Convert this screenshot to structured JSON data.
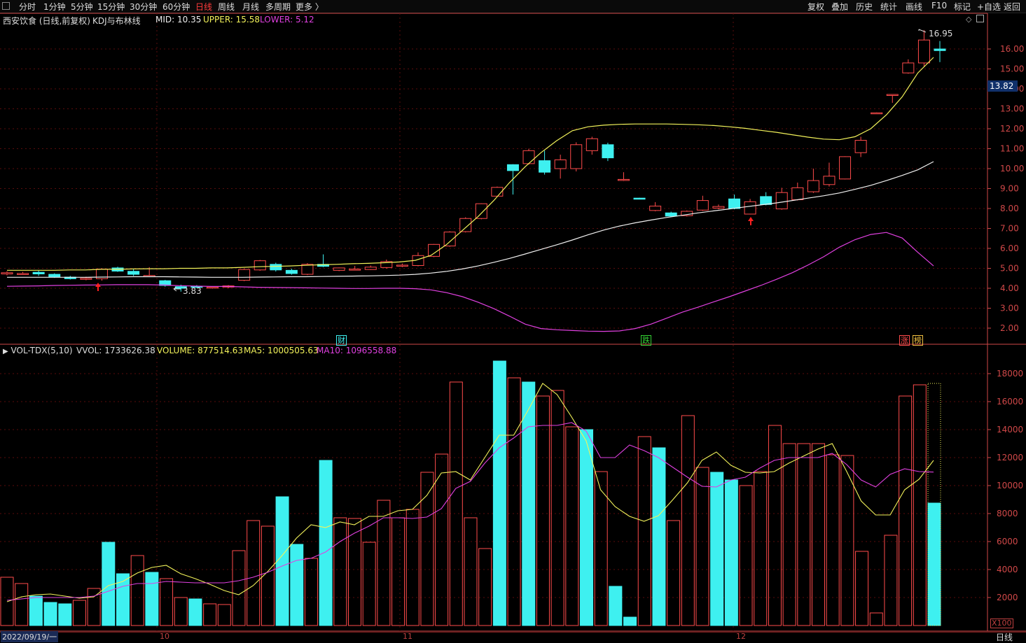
{
  "toolbar": {
    "left_items": [
      "分时",
      "1分钟",
      "5分钟",
      "15分钟",
      "30分钟",
      "60分钟",
      "日线",
      "周线",
      "月线",
      "多周期",
      "更多 〉"
    ],
    "active": "日线",
    "right_items": [
      "复权",
      "叠加",
      "历史",
      "统计",
      "画线",
      "F10",
      "标记",
      "+自选",
      "返回"
    ]
  },
  "main_info": {
    "title": "西安饮食 (日线,前复权)",
    "indicator": "KDJ与布林线",
    "mid": "MID: 10.35",
    "upper": "UPPER: 15.58",
    "lower": "LOWER: 5.12"
  },
  "vol_info": {
    "indicator": "VOL-TDX(5,10)",
    "vvol": "VVOL: 1733626.38",
    "volume": "VOLUME: 877514.63",
    "ma5": "MA5: 1000505.63",
    "ma10": "MA10: 1096558.88"
  },
  "colors": {
    "up": "#ff4b4b",
    "down": "#3ef0f0",
    "upper": "#f2f25a",
    "mid": "#f0f0f0",
    "lower": "#e040e0",
    "grid": "#5a0d0d",
    "axis": "#d04848"
  },
  "price_axis": [
    "16.00",
    "15.00",
    "14.00",
    "13.00",
    "12.00",
    "11.00",
    "10.00",
    "9.00",
    "8.00",
    "7.00",
    "6.00",
    "5.00",
    "4.00",
    "3.00",
    "2.00"
  ],
  "vol_axis": [
    "18000",
    "16000",
    "14000",
    "12000",
    "10000",
    "8000",
    "6000",
    "4000",
    "2000"
  ],
  "current_price": "13.82",
  "high_label": "16.95",
  "low_label": "3.83",
  "x_labels": [
    "10",
    "11",
    "12"
  ],
  "status": {
    "date": "2022/09/19/一",
    "period": "日线",
    "scale": "X100"
  },
  "markers": [
    {
      "text": "财",
      "color": "#3ef0f0"
    },
    {
      "text": "跌",
      "color": "#34d034"
    },
    {
      "text": "涨",
      "color": "#ff4b4b"
    },
    {
      "text": "榜",
      "color": "#f0c040"
    }
  ],
  "chart_data": {
    "type": "candlestick",
    "candles": [
      {
        "o": 4.72,
        "h": 4.85,
        "l": 4.65,
        "c": 4.78
      },
      {
        "o": 4.72,
        "h": 4.82,
        "l": 4.68,
        "c": 4.74
      },
      {
        "o": 4.8,
        "h": 4.88,
        "l": 4.62,
        "c": 4.72
      },
      {
        "o": 4.7,
        "h": 4.75,
        "l": 4.52,
        "c": 4.58
      },
      {
        "o": 4.56,
        "h": 4.62,
        "l": 4.44,
        "c": 4.48
      },
      {
        "o": 4.45,
        "h": 4.58,
        "l": 4.4,
        "c": 4.5
      },
      {
        "o": 4.48,
        "h": 5.0,
        "l": 4.38,
        "c": 4.96
      },
      {
        "o": 5.02,
        "h": 5.08,
        "l": 4.82,
        "c": 4.86
      },
      {
        "o": 4.85,
        "h": 4.95,
        "l": 4.62,
        "c": 4.7
      },
      {
        "o": 4.62,
        "h": 5.06,
        "l": 4.56,
        "c": 4.64
      },
      {
        "o": 4.38,
        "h": 4.42,
        "l": 4.08,
        "c": 4.14
      },
      {
        "o": 4.08,
        "h": 4.18,
        "l": 3.83,
        "c": 4.0
      },
      {
        "o": 4.1,
        "h": 4.16,
        "l": 4.02,
        "c": 4.06
      },
      {
        "o": 4.02,
        "h": 4.1,
        "l": 3.98,
        "c": 4.06
      },
      {
        "o": 4.06,
        "h": 4.16,
        "l": 4.0,
        "c": 4.12
      },
      {
        "o": 4.4,
        "h": 4.98,
        "l": 4.36,
        "c": 4.94
      },
      {
        "o": 4.92,
        "h": 5.42,
        "l": 4.88,
        "c": 5.38
      },
      {
        "o": 5.2,
        "h": 5.28,
        "l": 4.84,
        "c": 4.92
      },
      {
        "o": 4.9,
        "h": 4.98,
        "l": 4.68,
        "c": 4.74
      },
      {
        "o": 4.7,
        "h": 5.26,
        "l": 4.66,
        "c": 5.2
      },
      {
        "o": 5.2,
        "h": 5.7,
        "l": 5.06,
        "c": 5.1
      },
      {
        "o": 4.9,
        "h": 5.04,
        "l": 4.86,
        "c": 5.02
      },
      {
        "o": 4.94,
        "h": 5.12,
        "l": 4.9,
        "c": 4.96
      },
      {
        "o": 4.94,
        "h": 5.14,
        "l": 4.92,
        "c": 5.06
      },
      {
        "o": 5.04,
        "h": 5.44,
        "l": 4.98,
        "c": 5.34
      },
      {
        "o": 5.12,
        "h": 5.24,
        "l": 5.06,
        "c": 5.16
      },
      {
        "o": 5.14,
        "h": 5.8,
        "l": 5.1,
        "c": 5.64
      },
      {
        "o": 5.6,
        "h": 6.22,
        "l": 5.56,
        "c": 6.2
      },
      {
        "o": 6.12,
        "h": 6.86,
        "l": 6.08,
        "c": 6.82
      },
      {
        "o": 6.84,
        "h": 7.56,
        "l": 6.8,
        "c": 7.5
      },
      {
        "o": 7.5,
        "h": 8.26,
        "l": 7.46,
        "c": 8.24
      },
      {
        "o": 8.62,
        "h": 9.1,
        "l": 8.6,
        "c": 9.06
      },
      {
        "o": 10.2,
        "h": 10.22,
        "l": 8.7,
        "c": 9.9
      },
      {
        "o": 10.25,
        "h": 11.0,
        "l": 10.2,
        "c": 10.9
      },
      {
        "o": 10.4,
        "h": 10.9,
        "l": 9.7,
        "c": 9.82
      },
      {
        "o": 10.0,
        "h": 10.7,
        "l": 9.5,
        "c": 10.44
      },
      {
        "o": 10.0,
        "h": 11.32,
        "l": 9.86,
        "c": 11.2
      },
      {
        "o": 10.9,
        "h": 11.6,
        "l": 10.7,
        "c": 11.5
      },
      {
        "o": 11.2,
        "h": 11.3,
        "l": 10.38,
        "c": 10.54
      },
      {
        "o": 9.46,
        "h": 9.82,
        "l": 9.38,
        "c": 9.46
      },
      {
        "o": 8.52,
        "h": 8.54,
        "l": 8.48,
        "c": 8.5
      },
      {
        "o": 7.9,
        "h": 8.32,
        "l": 7.86,
        "c": 8.12
      },
      {
        "o": 7.78,
        "h": 7.84,
        "l": 7.58,
        "c": 7.62
      },
      {
        "o": 7.64,
        "h": 7.9,
        "l": 7.6,
        "c": 7.86
      },
      {
        "o": 7.92,
        "h": 8.64,
        "l": 7.88,
        "c": 8.4
      },
      {
        "o": 8.02,
        "h": 8.2,
        "l": 7.96,
        "c": 8.1
      },
      {
        "o": 8.48,
        "h": 8.7,
        "l": 7.96,
        "c": 8.0
      },
      {
        "o": 7.72,
        "h": 8.48,
        "l": 7.7,
        "c": 8.34
      },
      {
        "o": 8.6,
        "h": 8.82,
        "l": 8.16,
        "c": 8.2
      },
      {
        "o": 7.98,
        "h": 9.04,
        "l": 7.94,
        "c": 8.8
      },
      {
        "o": 8.44,
        "h": 9.3,
        "l": 8.4,
        "c": 9.04
      },
      {
        "o": 8.84,
        "h": 10.0,
        "l": 8.78,
        "c": 9.4
      },
      {
        "o": 9.2,
        "h": 10.3,
        "l": 9.1,
        "c": 9.62
      },
      {
        "o": 9.48,
        "h": 10.62,
        "l": 9.46,
        "c": 10.6
      },
      {
        "o": 10.8,
        "h": 11.6,
        "l": 10.58,
        "c": 11.42
      },
      {
        "o": 12.8,
        "h": 12.82,
        "l": 12.78,
        "c": 12.8
      },
      {
        "o": 13.7,
        "h": 13.72,
        "l": 13.3,
        "c": 13.72
      },
      {
        "o": 14.8,
        "h": 15.48,
        "l": 14.76,
        "c": 15.3
      },
      {
        "o": 15.3,
        "h": 16.95,
        "l": 15.1,
        "c": 16.45
      },
      {
        "o": 16.0,
        "h": 16.4,
        "l": 15.34,
        "c": 15.92
      }
    ],
    "upper": [
      4.9,
      4.9,
      4.9,
      4.9,
      4.92,
      4.92,
      4.95,
      4.95,
      4.97,
      4.98,
      4.98,
      5.0,
      5.0,
      5.02,
      5.02,
      5.05,
      5.08,
      5.1,
      5.12,
      5.15,
      5.18,
      5.2,
      5.23,
      5.25,
      5.28,
      5.32,
      5.4,
      5.65,
      6.2,
      6.9,
      7.6,
      8.4,
      9.3,
      10.1,
      10.8,
      11.4,
      11.9,
      12.1,
      12.18,
      12.22,
      12.24,
      12.24,
      12.24,
      12.22,
      12.2,
      12.16,
      12.1,
      12.02,
      11.92,
      11.82,
      11.7,
      11.58,
      11.48,
      11.45,
      11.6,
      12.0,
      12.7,
      13.6,
      14.8,
      15.58
    ],
    "mid": [
      4.55,
      4.55,
      4.55,
      4.55,
      4.55,
      4.55,
      4.56,
      4.57,
      4.58,
      4.58,
      4.58,
      4.57,
      4.56,
      4.55,
      4.55,
      4.55,
      4.56,
      4.57,
      4.58,
      4.58,
      4.59,
      4.6,
      4.61,
      4.62,
      4.64,
      4.66,
      4.7,
      4.76,
      4.85,
      4.97,
      5.12,
      5.3,
      5.5,
      5.72,
      5.95,
      6.18,
      6.42,
      6.68,
      6.92,
      7.12,
      7.28,
      7.42,
      7.55,
      7.66,
      7.78,
      7.88,
      7.98,
      8.08,
      8.18,
      8.28,
      8.4,
      8.52,
      8.64,
      8.78,
      8.96,
      9.16,
      9.4,
      9.66,
      9.94,
      10.35
    ],
    "lower": [
      4.1,
      4.11,
      4.12,
      4.14,
      4.15,
      4.16,
      4.17,
      4.18,
      4.18,
      4.18,
      4.16,
      4.13,
      4.11,
      4.09,
      4.09,
      4.07,
      4.05,
      4.04,
      4.03,
      4.02,
      4.01,
      4.0,
      3.99,
      3.99,
      4.0,
      4.0,
      3.98,
      3.92,
      3.78,
      3.58,
      3.3,
      2.98,
      2.6,
      2.2,
      1.98,
      1.92,
      1.88,
      1.85,
      1.84,
      1.86,
      1.98,
      2.2,
      2.5,
      2.8,
      3.05,
      3.32,
      3.58,
      3.86,
      4.14,
      4.45,
      4.78,
      5.16,
      5.58,
      6.06,
      6.44,
      6.7,
      6.8,
      6.52,
      5.8,
      5.12
    ],
    "volume": [
      3450,
      3000,
      2100,
      1650,
      1550,
      1800,
      2650,
      5950,
      3700,
      5000,
      3800,
      3350,
      2000,
      1900,
      1550,
      1500,
      5350,
      7500,
      7100,
      9200,
      5800,
      4800,
      11800,
      7700,
      7650,
      5950,
      8950,
      7700,
      8300,
      10950,
      12250,
      17400,
      7700,
      5500,
      18900,
      17700,
      17400,
      16400,
      16800,
      14200,
      14000,
      11000,
      2800,
      600,
      13500,
      12700,
      7500,
      15000,
      11300,
      10950,
      10400,
      10000,
      11000,
      14300,
      13000,
      13000,
      13000,
      12200,
      12150,
      5300,
      900,
      6450,
      16400,
      17200,
      8750
    ],
    "vol_down": [
      false,
      false,
      true,
      true,
      true,
      false,
      false,
      true,
      true,
      false,
      true,
      false,
      false,
      true,
      false,
      false,
      false,
      false,
      false,
      true,
      true,
      false,
      true,
      false,
      false,
      false,
      false,
      false,
      false,
      false,
      false,
      false,
      false,
      false,
      true,
      false,
      true,
      false,
      false,
      false,
      true,
      false,
      true,
      true,
      false,
      true,
      false,
      false,
      false,
      true,
      true,
      false,
      false,
      false,
      false,
      false,
      false,
      false,
      false,
      false,
      false,
      false,
      false,
      false,
      true
    ],
    "ma5": [
      1700,
      2050,
      2200,
      2250,
      2100,
      1950,
      2050,
      2850,
      3150,
      3750,
      4150,
      4300,
      3700,
      3350,
      2950,
      2500,
      2200,
      2850,
      3850,
      5000,
      6250,
      7200,
      7000,
      7400,
      7200,
      7800,
      7800,
      8200,
      8300,
      9300,
      10900,
      11000,
      10400,
      12000,
      13600,
      13600,
      15400,
      17300,
      16500,
      14900,
      13200,
      9700,
      8500,
      7800,
      7450,
      7850,
      9000,
      10200,
      11800,
      12400,
      11450,
      10950,
      10900,
      11000,
      11600,
      12100,
      12600,
      13000,
      11000,
      8900,
      7900,
      7900,
      9700,
      10450,
      11800
    ],
    "ma10": [
      1800,
      1900,
      2000,
      2000,
      2000,
      2000,
      2100,
      2450,
      2800,
      3000,
      3000,
      3150,
      3100,
      3050,
      3050,
      3050,
      3200,
      3450,
      3800,
      4250,
      4650,
      4800,
      5250,
      6000,
      6600,
      7100,
      7700,
      7700,
      7650,
      7750,
      8350,
      9800,
      10300,
      11600,
      12700,
      13400,
      14200,
      14300,
      14300,
      14500,
      13900,
      12000,
      12000,
      12900,
      12500,
      12000,
      11300,
      10600,
      9950,
      9900,
      10400,
      10600,
      11250,
      11800,
      12000,
      12000,
      12000,
      12300,
      11500,
      10400,
      9900,
      10800,
      11200,
      11000,
      10965
    ]
  }
}
